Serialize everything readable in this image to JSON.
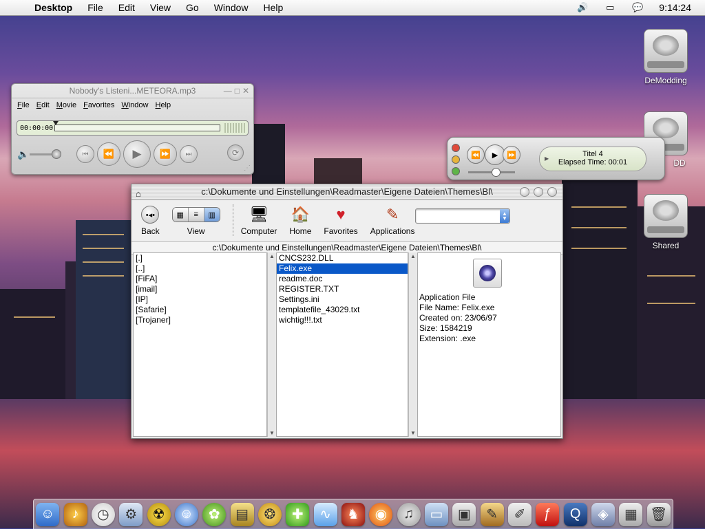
{
  "menubar": {
    "app": "Desktop",
    "items": [
      "File",
      "Edit",
      "View",
      "Go",
      "Window",
      "Help"
    ],
    "clock": "9:14:24"
  },
  "desktop": {
    "disks": [
      "DeModding",
      "DD",
      "Shared"
    ]
  },
  "quicktime": {
    "title": "Nobody's Listeni...METEORA.mp3",
    "menu": [
      "File",
      "Edit",
      "Movie",
      "Favorites",
      "Window",
      "Help"
    ],
    "time": "00:00:00"
  },
  "itunes": {
    "line1": "Titel 4",
    "line2": "Elapsed Time: 00:01"
  },
  "finder": {
    "title": "c:\\Dokumente und Einstellungen\\Readmaster\\Eigene Dateien\\Themes\\Bl\\",
    "path": "c:\\Dokumente und Einstellungen\\Readmaster\\Eigene Dateien\\Themes\\Bl\\",
    "toolbar": {
      "back": "Back",
      "view": "View",
      "computer": "Computer",
      "home": "Home",
      "favorites": "Favorites",
      "applications": "Applications"
    },
    "folders": [
      "[.]",
      "[..]",
      "[FiFA]",
      "[imail]",
      "[IP]",
      "[Safarie]",
      "[Trojaner]"
    ],
    "files": [
      "CNCS232.DLL",
      "Felix.exe",
      "readme.doc",
      "REGISTER.TXT",
      "Settings.ini",
      "templatefile_43029.txt",
      "wichtig!!!.txt"
    ],
    "selected_file_index": 1,
    "info": {
      "kind": "Application File",
      "file_name": "File Name: Felix.exe",
      "created": "Created on: 23/06/97",
      "size": "Size: 1584219",
      "extension": "Extension: .exe"
    }
  },
  "dock": {
    "icons": [
      "finder-icon",
      "itunes-icon",
      "clock-icon",
      "system-prefs-icon",
      "radiation-icon",
      "ichat-icon",
      "icq-icon",
      "toolbox-icon",
      "fonts-icon",
      "frog-icon",
      "wave-icon",
      "mozilla-icon",
      "cd-icon",
      "music-icon",
      "folder-icon",
      "monitor-icon",
      "pens-icon",
      "graphics-icon",
      "flash-icon",
      "quicktime-icon",
      "cube-icon",
      "calculator-icon",
      "trash-icon"
    ]
  }
}
